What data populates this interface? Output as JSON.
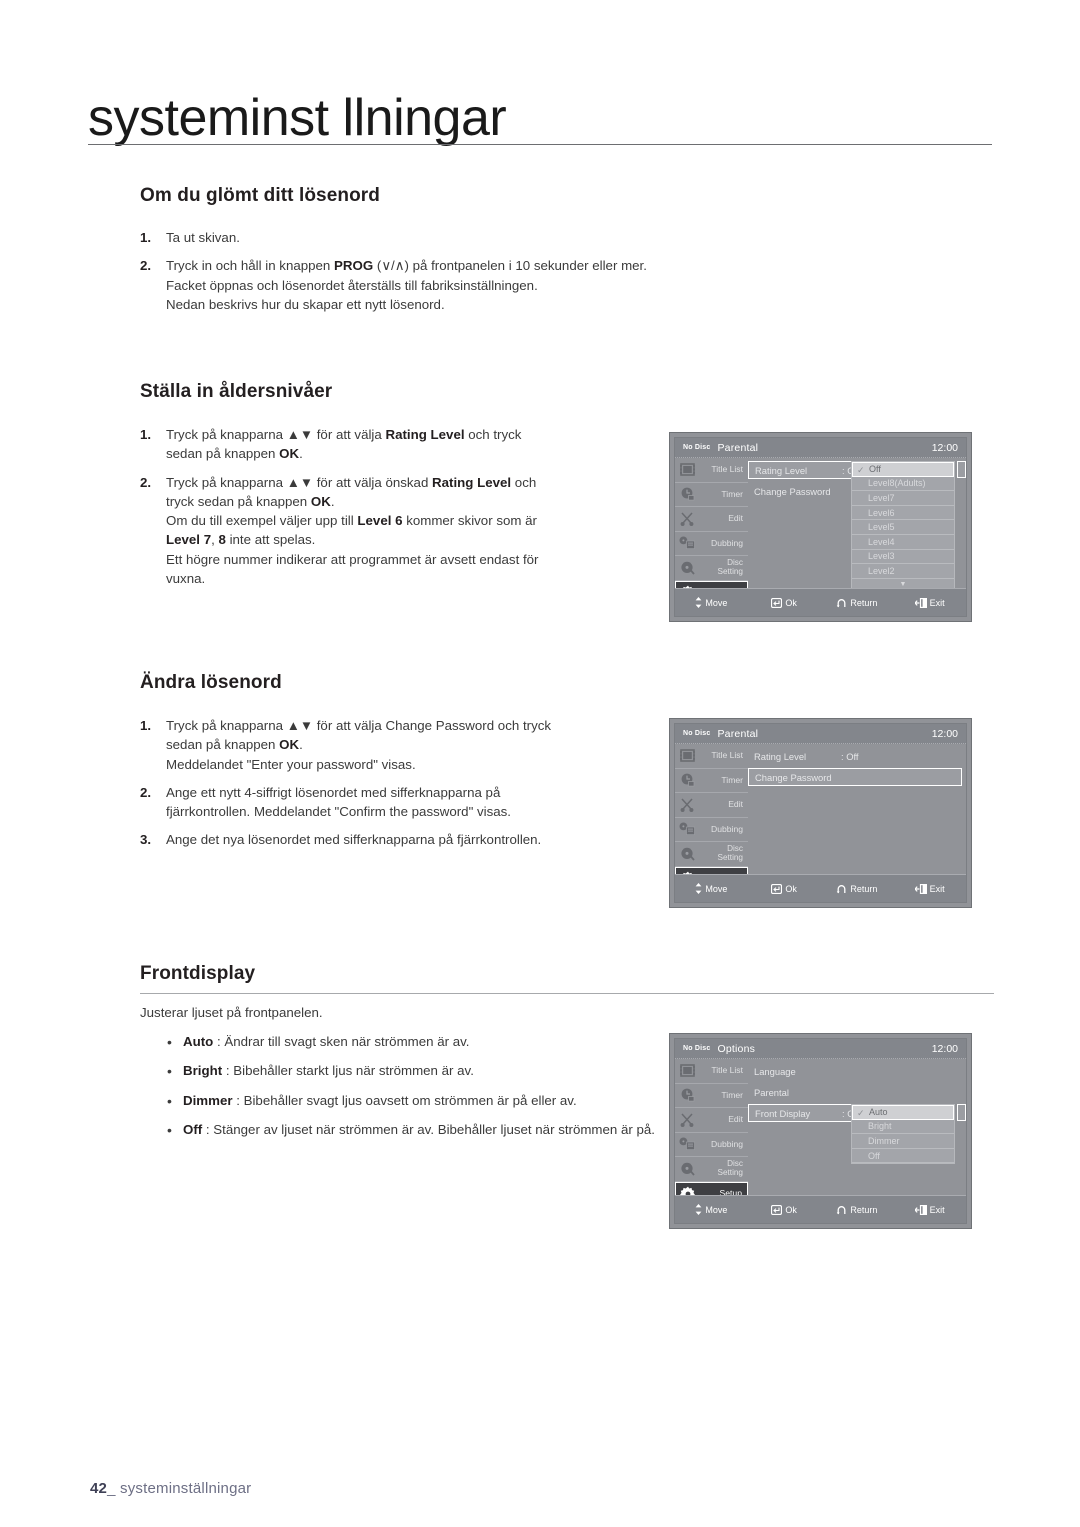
{
  "page": {
    "title": "systeminst llningar",
    "footer_number": "42",
    "footer_label": "systeminställningar"
  },
  "sections": {
    "forgot_password": {
      "heading": "Om du glömt ditt lösenord",
      "steps": [
        {
          "num": "1.",
          "lines": [
            "Ta ut skivan."
          ]
        },
        {
          "num": "2.",
          "lines": [
            "Tryck in och håll in knappen PROG (∨/∧) på frontpanelen i 10 sekunder eller mer.",
            "Facket öppnas och lösenordet återställs till fabriksinställningen.",
            "Nedan beskrivs hur du skapar ett nytt lösenord."
          ]
        }
      ]
    },
    "rating_levels": {
      "heading": "Ställa in åldersnivåer",
      "steps": [
        {
          "num": "1.",
          "lines": [
            "Tryck på knapparna ▲▼ för att välja Rating Level och tryck",
            "sedan på knappen OK."
          ]
        },
        {
          "num": "2.",
          "lines": [
            "Tryck på knapparna ▲▼ för att välja önskad Rating Level och",
            "tryck sedan på knappen OK.",
            "Om du till exempel väljer upp till Level 6 kommer skivor som är",
            "Level 7, 8 inte att spelas.",
            "Ett högre nummer indikerar att programmet är avsett endast för",
            "vuxna."
          ]
        }
      ]
    },
    "change_password": {
      "heading": "Ändra lösenord",
      "steps": [
        {
          "num": "1.",
          "lines": [
            "Tryck på knapparna ▲▼ för att välja Change Password och tryck",
            "sedan på knappen OK.",
            "Meddelandet \"Enter your password\" visas."
          ]
        },
        {
          "num": "2.",
          "lines": [
            "Ange ett nytt 4-siffrigt lösenordet med sifferknapparna på",
            "fjärrkontrollen. Meddelandet \"Confirm the password\" visas."
          ]
        },
        {
          "num": "3.",
          "lines": [
            "Ange det nya lösenordet med sifferknapparna på fjärrkontrollen."
          ]
        }
      ]
    },
    "front_display": {
      "heading": "Frontdisplay",
      "intro": "Justerar ljuset på frontpanelen.",
      "bullets": [
        {
          "term": "Auto",
          "sep": " : ",
          "text": "Ändrar till svagt sken när strömmen är av."
        },
        {
          "term": "Bright",
          "sep": " : ",
          "text": "Bibehåller starkt ljus när strömmen är av."
        },
        {
          "term": "Dimmer",
          "sep": " : ",
          "text": "Bibehåller svagt ljus oavsett om strömmen är på eller av."
        },
        {
          "term": "Off",
          "sep": " : ",
          "text": "Stänger av ljuset när strömmen är av. Bibehåller ljuset när strömmen är på."
        }
      ]
    }
  },
  "osd_common": {
    "no_disc": "No Disc",
    "clock": "12:00",
    "sidebar": [
      {
        "label": "Title List",
        "icon": "film-strip-icon",
        "active": false
      },
      {
        "label": "Timer",
        "icon": "timer-clock-icon",
        "active": false
      },
      {
        "label": "Edit",
        "icon": "scissors-icon",
        "active": false
      },
      {
        "label": "Dubbing",
        "icon": "dubbing-icon",
        "active": false
      },
      {
        "label": "Disc Setting",
        "icon": "disc-icon",
        "active": false
      },
      {
        "label": "Setup",
        "icon": "gear-icon",
        "active": true
      }
    ],
    "footer": [
      {
        "label": "Move",
        "icon": "up-down-arrow-icon"
      },
      {
        "label": "Ok",
        "icon": "enter-key-icon"
      },
      {
        "label": "Return",
        "icon": "return-arrow-icon"
      },
      {
        "label": "Exit",
        "icon": "exit-icon"
      }
    ]
  },
  "osd_parental_rating": {
    "title": "Parental",
    "rows": [
      {
        "label": "Rating Level",
        "value": ": Off",
        "selected": true
      },
      {
        "label": "Change Password",
        "value": "",
        "selected": false
      }
    ],
    "dropdown": {
      "items": [
        "Off",
        "Level8(Adults)",
        "Level7",
        "Level6",
        "Level5",
        "Level4",
        "Level3",
        "Level2"
      ],
      "selected": "Off",
      "more_indicator": "▼"
    }
  },
  "osd_parental_password": {
    "title": "Parental",
    "rows": [
      {
        "label": "Rating Level",
        "value": ": Off",
        "selected": false
      },
      {
        "label": "Change Password",
        "value": "",
        "selected": true
      }
    ]
  },
  "osd_options_front_display": {
    "title": "Options",
    "rows": [
      {
        "label": "Language",
        "value": "",
        "selected": false
      },
      {
        "label": "Parental",
        "value": "",
        "selected": false
      },
      {
        "label": "Front Display",
        "value": ": O",
        "selected": true
      }
    ],
    "dropdown": {
      "items": [
        "Auto",
        "Bright",
        "Dimmer",
        "Off"
      ],
      "selected": "Auto"
    }
  },
  "colors": {
    "osd_bg": "#919398",
    "osd_bar": "#83868c",
    "osd_active": "#3e3f43",
    "dropdown_bg": "#a3a5aa",
    "dropdown_selected": "#cfd0d3",
    "text_body": "#3b3b3b",
    "footer_text": "#6d6f85"
  }
}
